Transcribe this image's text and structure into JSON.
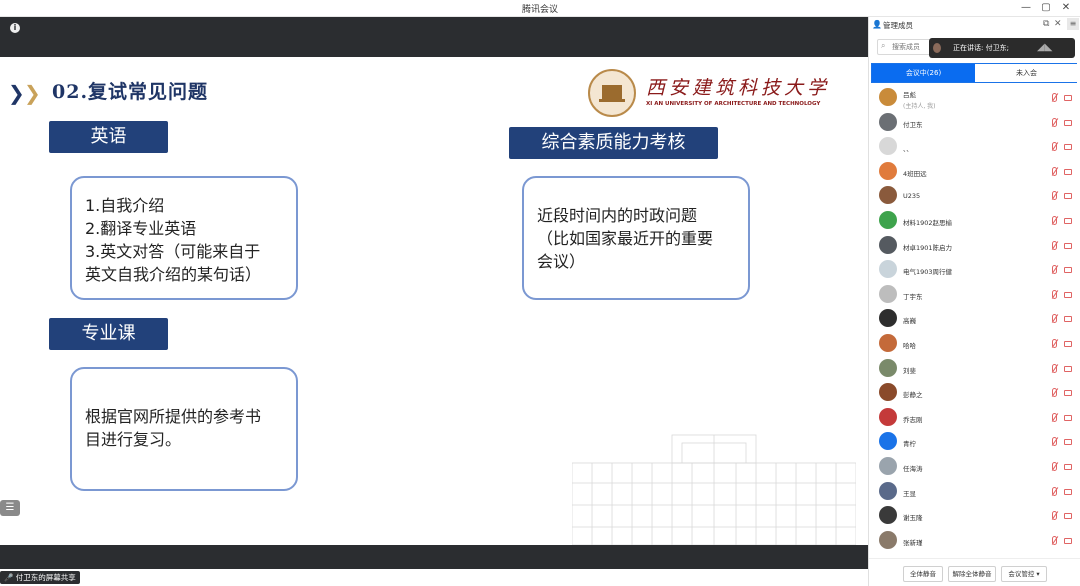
{
  "window": {
    "title": "腾讯会议",
    "minimize": "—",
    "maximize": "▢",
    "close": "✕"
  },
  "stage": {
    "info_icon": "info-icon"
  },
  "slide": {
    "title": "02.复试常见问题",
    "logo": {
      "cn": "西安建筑科技大学",
      "en": "XI AN UNIVERSITY OF ARCHITECTURE AND TECHNOLOGY"
    },
    "sections": {
      "english": {
        "tag": "英语",
        "lines": [
          "1.自我介绍",
          "2.翻译专业英语",
          "3.英文对答（可能来自于",
          "英文自我介绍的某句话）"
        ]
      },
      "major": {
        "tag": "专业课",
        "lines": [
          "根据官网所提供的参考书",
          "目进行复习。"
        ]
      },
      "quality": {
        "tag": "综合素质能力考核",
        "lines": [
          "近段时间内的时政问题",
          "（比如国家最近开的重要",
          "会议）"
        ]
      }
    }
  },
  "status": {
    "share_label": "付卫东的屏幕共享"
  },
  "panel": {
    "title": "管理成员",
    "search_placeholder": "搜索成员",
    "speaking": "正在讲话: 付卫东;",
    "tabs": {
      "in_meeting": "会议中(26)",
      "not_joined": "未入会"
    },
    "participants": [
      {
        "name": "吕彪",
        "sub": "(主持人, 我)",
        "color": "#c98b3a"
      },
      {
        "name": "付卫东",
        "sub": "",
        "color": "#6b6f74"
      },
      {
        "name": "、、",
        "sub": "",
        "color": "#d8d8d8"
      },
      {
        "name": "4班田远",
        "sub": "",
        "color": "#e07b3c"
      },
      {
        "name": "U235",
        "sub": "",
        "color": "#8a5a3c"
      },
      {
        "name": "材料1902赵思榆",
        "sub": "",
        "color": "#3ea34c"
      },
      {
        "name": "材卓1901陈启力",
        "sub": "",
        "color": "#555a60"
      },
      {
        "name": "电气1903周行健",
        "sub": "",
        "color": "#c9d4db"
      },
      {
        "name": "丁宇东",
        "sub": "",
        "color": "#bdbdbd"
      },
      {
        "name": "高巍",
        "sub": "",
        "color": "#2e2e2e"
      },
      {
        "name": "哈哈",
        "sub": "",
        "color": "#c46a3a"
      },
      {
        "name": "刘斐",
        "sub": "",
        "color": "#7a8a6a"
      },
      {
        "name": "彭静之",
        "sub": "",
        "color": "#8a4a2a"
      },
      {
        "name": "乔志刚",
        "sub": "",
        "color": "#c43a3a"
      },
      {
        "name": "青柠",
        "sub": "",
        "color": "#1a73e8"
      },
      {
        "name": "任海涛",
        "sub": "",
        "color": "#9aa4ad"
      },
      {
        "name": "王显",
        "sub": "",
        "color": "#5a6a8a"
      },
      {
        "name": "谢玉隆",
        "sub": "",
        "color": "#3a3a3a"
      },
      {
        "name": "张新瑾",
        "sub": "",
        "color": "#8a7a6a"
      }
    ],
    "footer": {
      "mute_all": "全体静音",
      "unmute_all": "解除全体静音",
      "meeting_control": "会议管控"
    }
  },
  "colors": {
    "navy": "#22417a",
    "card_border": "#7b98d2",
    "accent_blue": "#0a6cf0",
    "dark_bg": "#2b2d30"
  }
}
